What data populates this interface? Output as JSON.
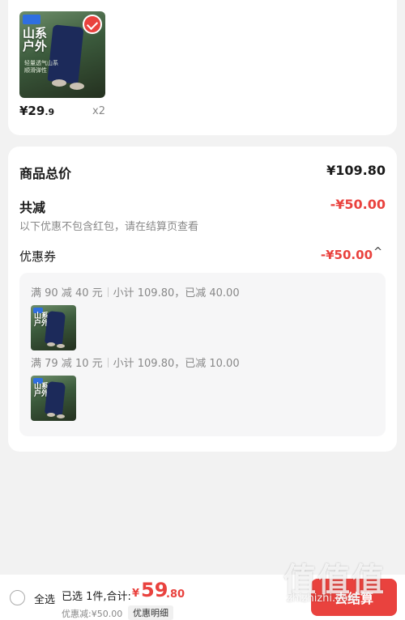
{
  "product": {
    "brand_tag": "山系\n户外",
    "caption": "轻量透气山系\n顺滑弹性",
    "price_int": "¥29",
    "price_dec": ".9",
    "qty": "x2"
  },
  "summary": {
    "total_label": "商品总价",
    "total_value": "¥109.80",
    "reduce_label": "共减",
    "reduce_value": "-¥50.00",
    "note": "以下优惠不包含红包，请在结算页查看",
    "coupon_label": "优惠券",
    "coupon_value": "-¥50.00",
    "coupon_caret": "^"
  },
  "promos": [
    {
      "rule": "满 90 减 40 元",
      "detail": "小计 109.80，已减 40.00",
      "brand_tag": "山系\n户外"
    },
    {
      "rule": "满 79 减 10 元",
      "detail": "小计 109.80，已减 10.00",
      "brand_tag": "山系\n户外"
    }
  ],
  "bottom": {
    "select_all": "全选",
    "selected_total_label": "已选 1件,合计:",
    "total_yen": "¥",
    "total_int": "59",
    "total_dec": ".80",
    "discount_text": "优惠减:¥50.00",
    "details_label": "优惠明细",
    "checkout_label": "去结算"
  },
  "watermark": {
    "glyphs": "值值值",
    "site": "zhizhizhi.com"
  },
  "colors": {
    "accent": "#e9423e",
    "background": "#f2f2f2",
    "card": "#ffffff"
  }
}
